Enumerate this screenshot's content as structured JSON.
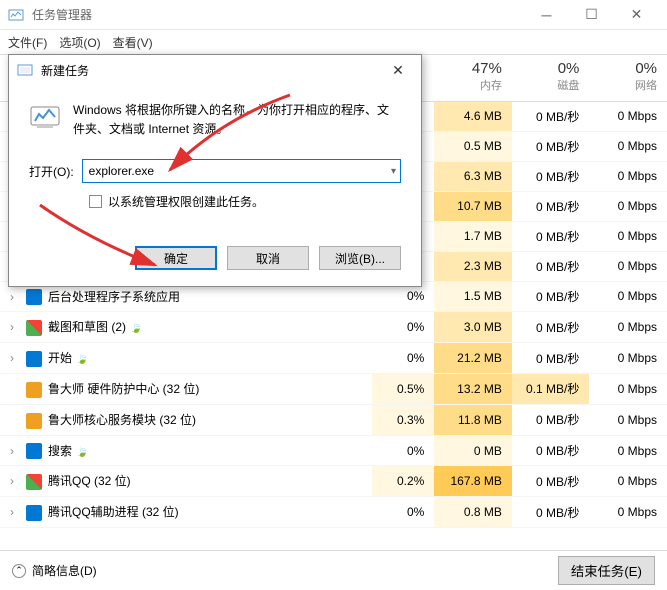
{
  "app": {
    "title": "任务管理器"
  },
  "menu": {
    "file": "文件(F)",
    "options": "选项(O)",
    "view": "查看(V)"
  },
  "columns": {
    "mem_pct": "47%",
    "mem_lbl": "内存",
    "disk_pct": "0%",
    "disk_lbl": "磁盘",
    "net_pct": "0%",
    "net_lbl": "网络"
  },
  "rows": [
    {
      "name": "",
      "pct": "",
      "mem": "4.6 MB",
      "disk": "0 MB/秒",
      "net": "0 Mbps"
    },
    {
      "name": "",
      "pct": "",
      "mem": "0.5 MB",
      "disk": "0 MB/秒",
      "net": "0 Mbps"
    },
    {
      "name": "",
      "pct": "",
      "mem": "6.3 MB",
      "disk": "0 MB/秒",
      "net": "0 Mbps"
    },
    {
      "name": "",
      "pct": "",
      "mem": "10.7 MB",
      "disk": "0 MB/秒",
      "net": "0 Mbps"
    },
    {
      "name": "",
      "pct": "",
      "mem": "1.7 MB",
      "disk": "0 MB/秒",
      "net": "0 Mbps"
    },
    {
      "name": "",
      "pct": "",
      "mem": "2.3 MB",
      "disk": "0 MB/秒",
      "net": "0 Mbps"
    },
    {
      "name": "后台处理程序子系统应用",
      "pct": "0%",
      "mem": "1.5 MB",
      "disk": "0 MB/秒",
      "net": "0 Mbps",
      "icon": "blue",
      "expand": true
    },
    {
      "name": "截图和草图 (2)",
      "pct": "0%",
      "mem": "3.0 MB",
      "disk": "0 MB/秒",
      "net": "0 Mbps",
      "icon": "multi",
      "expand": true,
      "leaf": true
    },
    {
      "name": "开始",
      "pct": "0%",
      "mem": "21.2 MB",
      "disk": "0 MB/秒",
      "net": "0 Mbps",
      "icon": "blue",
      "expand": true,
      "leaf": true
    },
    {
      "name": "鲁大师 硬件防护中心 (32 位)",
      "pct": "0.5%",
      "mem": "13.2 MB",
      "disk": "0.1 MB/秒",
      "net": "0 Mbps",
      "icon": "orange"
    },
    {
      "name": "鲁大师核心服务模块 (32 位)",
      "pct": "0.3%",
      "mem": "11.8 MB",
      "disk": "0 MB/秒",
      "net": "0 Mbps",
      "icon": "orange"
    },
    {
      "name": "搜索",
      "pct": "0%",
      "mem": "0 MB",
      "disk": "0 MB/秒",
      "net": "0 Mbps",
      "icon": "blue",
      "expand": true,
      "leaf": true
    },
    {
      "name": "腾讯QQ (32 位)",
      "pct": "0.2%",
      "mem": "167.8 MB",
      "disk": "0 MB/秒",
      "net": "0 Mbps",
      "icon": "multi",
      "expand": true
    },
    {
      "name": "腾讯QQ辅助进程 (32 位)",
      "pct": "0%",
      "mem": "0.8 MB",
      "disk": "0 MB/秒",
      "net": "0 Mbps",
      "icon": "blue",
      "expand": true
    }
  ],
  "statusbar": {
    "brief": "简略信息(D)",
    "end": "结束任务(E)"
  },
  "dialog": {
    "title": "新建任务",
    "desc": "Windows 将根据你所键入的名称，为你打开相应的程序、文件夹、文档或 Internet 资源。",
    "open_label": "打开(O):",
    "value": "explorer.exe",
    "admin_check": "以系统管理权限创建此任务。",
    "ok": "确定",
    "cancel": "取消",
    "browse": "浏览(B)..."
  }
}
